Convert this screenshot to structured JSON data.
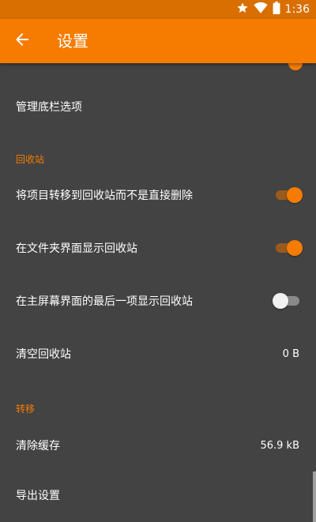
{
  "status_bar": {
    "time": "1:36",
    "icons": [
      "star-icon",
      "wifi-icon",
      "battery-icon"
    ]
  },
  "app_bar": {
    "title": "设置",
    "back_icon": "arrow-left-icon"
  },
  "colors": {
    "accent": "#f57c00",
    "status_bar": "#d86f00",
    "background": "#434343",
    "text": "#ffffff"
  },
  "settings": {
    "manage_bottom_bar": "管理底栏选项",
    "recycle_bin": {
      "header": "回收站",
      "move_to_recycle_bin": {
        "label": "将项目转移到回收站而不是直接删除",
        "enabled": true
      },
      "show_in_folders": {
        "label": "在文件夹界面显示回收站",
        "enabled": true
      },
      "show_last_on_main": {
        "label": "在主屏幕界面的最后一项显示回收站",
        "enabled": false
      },
      "empty_recycle_bin": {
        "label": "清空回收站",
        "value": "0 B"
      }
    },
    "transfer": {
      "header": "转移",
      "clear_cache": {
        "label": "清除缓存",
        "value": "56.9 kB"
      },
      "export_settings": {
        "label": "导出设置"
      }
    }
  }
}
